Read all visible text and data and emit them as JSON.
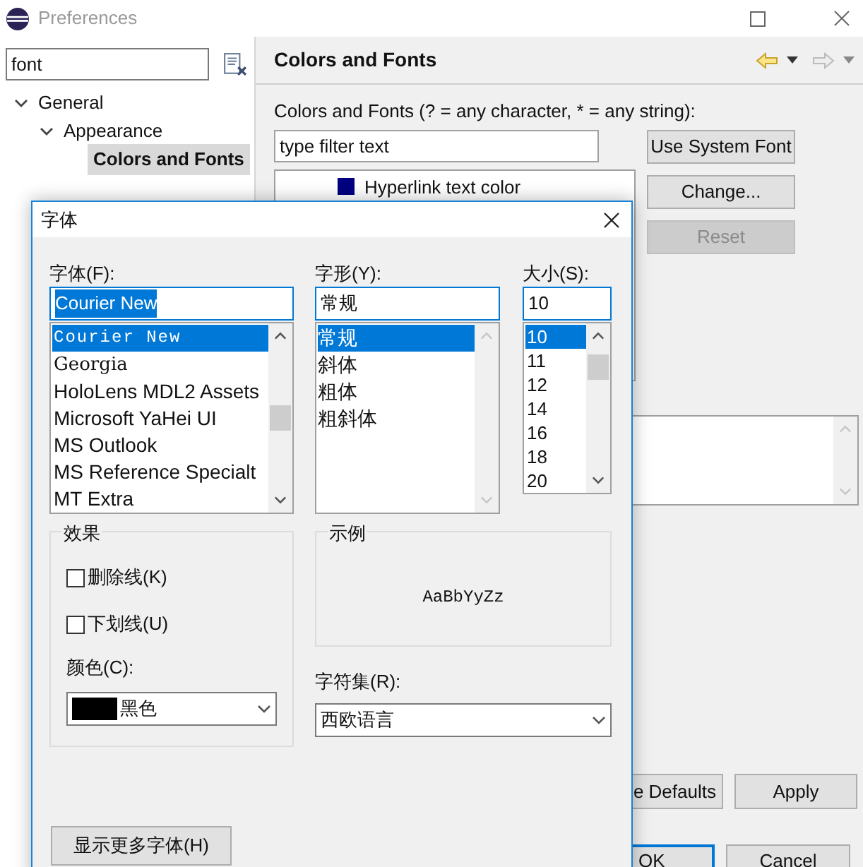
{
  "window": {
    "title": "Preferences"
  },
  "sidebar": {
    "search": {
      "value": "font"
    },
    "tree": [
      {
        "label": "General",
        "expanded": true,
        "children": [
          {
            "label": "Appearance",
            "expanded": true,
            "children": [
              {
                "label": "Colors and Fonts",
                "selected": true
              }
            ]
          }
        ]
      }
    ]
  },
  "page": {
    "title": "Colors and Fonts",
    "filter_label": "Colors and Fonts (? = any character, * = any string):",
    "filter": {
      "placeholder": "type filter text"
    },
    "items": [
      {
        "label": "Hyperlink text color",
        "color": "#000080"
      }
    ],
    "buttons": [
      {
        "label": "Use System Font",
        "disabled": false
      },
      {
        "label": "Change...",
        "disabled": false
      },
      {
        "label": "Reset",
        "disabled": true
      }
    ]
  },
  "footer_buttons": [
    {
      "label": "e Defaults"
    },
    {
      "label": "Apply"
    }
  ],
  "dialog_buttons": [
    {
      "label": "OK",
      "default": true
    },
    {
      "label": "Cancel",
      "default": false
    }
  ],
  "font_dialog": {
    "title": "字体",
    "font": {
      "label": "字体(F):",
      "value": "Courier New",
      "items": [
        {
          "label": "Courier New",
          "kind": "mono",
          "selected": true
        },
        {
          "label": "Georgia",
          "kind": "serif",
          "selected": false
        },
        {
          "label": "HoloLens MDL2 Assets",
          "kind": "sans",
          "selected": false
        },
        {
          "label": "Microsoft YaHei UI",
          "kind": "sans",
          "selected": false
        },
        {
          "label": "MS Outlook",
          "kind": "sans",
          "selected": false
        },
        {
          "label": "MS Reference Specialt",
          "kind": "sans",
          "selected": false
        },
        {
          "label": "MT Extra",
          "kind": "sans",
          "selected": false
        }
      ]
    },
    "style": {
      "label": "字形(Y):",
      "value": "常规",
      "items": [
        {
          "label": "常规",
          "selected": true
        },
        {
          "label": "斜体",
          "selected": false
        },
        {
          "label": "粗体",
          "selected": false
        },
        {
          "label": "粗斜体",
          "selected": false
        }
      ]
    },
    "size": {
      "label": "大小(S):",
      "value": "10",
      "items": [
        {
          "label": "10",
          "selected": true
        },
        {
          "label": "11",
          "selected": false
        },
        {
          "label": "12",
          "selected": false
        },
        {
          "label": "14",
          "selected": false
        },
        {
          "label": "16",
          "selected": false
        },
        {
          "label": "18",
          "selected": false
        },
        {
          "label": "20",
          "selected": false
        }
      ]
    },
    "effects": {
      "title": "效果",
      "options": [
        {
          "label": "删除线(K)",
          "checked": false
        },
        {
          "label": "下划线(U)",
          "checked": false
        }
      ]
    },
    "color_picker": {
      "label": "颜色(C):",
      "value": "黑色",
      "color": "#000000"
    },
    "sample": {
      "title": "示例",
      "text": "AaBbYyZz"
    },
    "charset": {
      "label": "字符集(R):",
      "value": "西欧语言"
    },
    "more_button": "显示更多字体(H)"
  }
}
